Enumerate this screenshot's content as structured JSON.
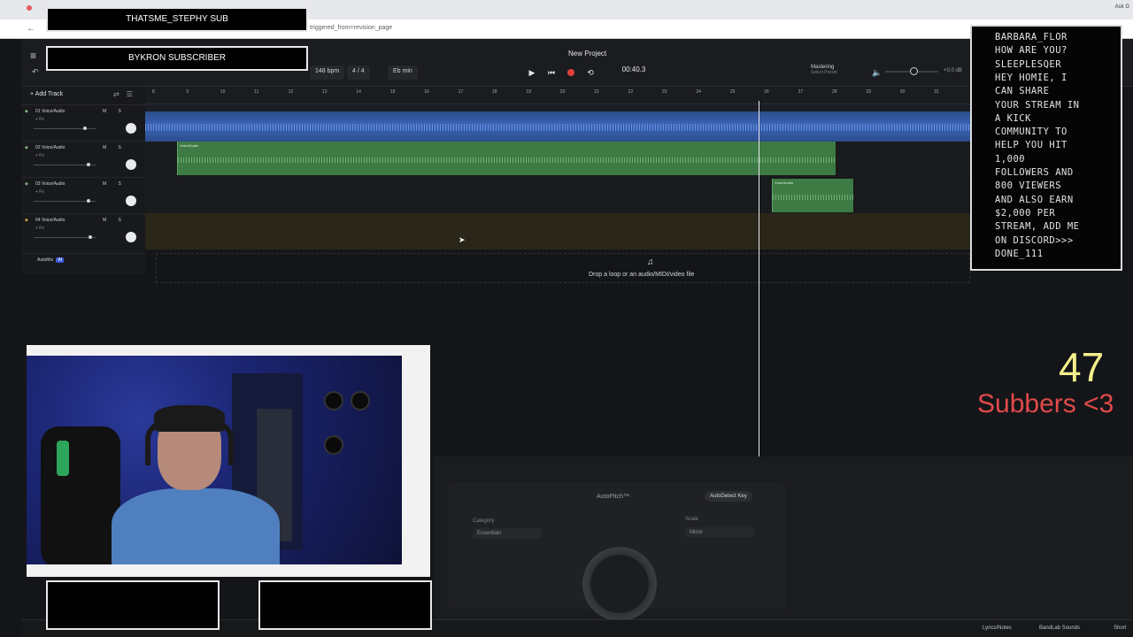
{
  "browser": {
    "url_fragment": "triggered_from=revision_page",
    "right_tab": "Ask G"
  },
  "header": {
    "project_title": "New Project",
    "bpm": "148 bpm",
    "time_signature": "4 / 4",
    "key": "Eb min",
    "time": "00:40.3",
    "mastering_label": "Mastering",
    "mastering_sub": "Select Preset",
    "db": "+0.0 dB"
  },
  "tracks": {
    "add_label": "Add Track",
    "items": [
      {
        "name": "01 Voice/Audio",
        "fx": "+ Fx"
      },
      {
        "name": "02 Voice/Audio",
        "fx": "+ Fx"
      },
      {
        "name": "03 Voice/Audio",
        "fx": "+ Fx"
      },
      {
        "name": "04 Voice/Audio",
        "fx": "+ Fx"
      }
    ],
    "msb": "M S",
    "automix": "AutoMix",
    "ai": "AI"
  },
  "ruler": [
    "8",
    "9",
    "10",
    "11",
    "12",
    "13",
    "14",
    "15",
    "16",
    "17",
    "18",
    "19",
    "20",
    "21",
    "22",
    "23",
    "24",
    "25",
    "26",
    "27",
    "28",
    "29",
    "30",
    "31"
  ],
  "clip_label": "Voice/Audio",
  "drop": {
    "text": "Drop a loop or an audio/MIDI/video file"
  },
  "autopitch": {
    "title": "AutoPitch™",
    "detect": "AutoDetect Key",
    "category_label": "Category",
    "category_value": "Essentials",
    "scale_label": "Scale",
    "scale_value": "Minor"
  },
  "footer": {
    "lyrics": "Lyrics/Notes",
    "sounds": "BandLab Sounds",
    "shortcuts": "Short"
  },
  "overlay": {
    "banner1": "THATSME_STEPHY SUB",
    "banner2": "BYKRON SUBSCRIBER",
    "chat": [
      "BARBARA_FLOR",
      "HOW ARE YOU?",
      "SLEEPLESQER",
      "HEY HOMIE, I",
      "CAN SHARE",
      "YOUR STREAM IN",
      "A KICK",
      "COMMUNITY TO",
      "HELP YOU HIT",
      "1,000",
      "FOLLOWERS AND",
      "800 VIEWERS",
      "AND ALSO EARN",
      "$2,000 PER",
      "STREAM, ADD ME",
      "ON DISCORD>>>",
      "DONE_111"
    ],
    "count": "47",
    "subbers": "Subbers <3"
  },
  "colors": {
    "accent_blue": "#3a65b8",
    "accent_green": "#3e7a44",
    "record_red": "#e2413b",
    "count_yellow": "#f4ef8a",
    "subbers_red": "#e14a4a"
  }
}
